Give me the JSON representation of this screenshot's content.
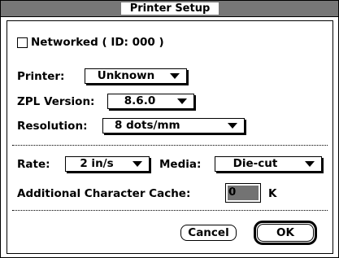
{
  "window": {
    "title": "Printer Setup"
  },
  "networked": {
    "label": "Networked ( ID:  000 )",
    "checked": false
  },
  "printer": {
    "label": "Printer:",
    "value": "Unknown"
  },
  "zpl_version": {
    "label": "ZPL Version:",
    "value": "8.6.0"
  },
  "resolution": {
    "label": "Resolution:",
    "value": "8 dots/mm"
  },
  "rate": {
    "label": "Rate:",
    "value": "2 in/s"
  },
  "media": {
    "label": "Media:",
    "value": "Die-cut"
  },
  "cache": {
    "label": "Additional Character Cache:",
    "value": "0",
    "unit": "K"
  },
  "buttons": {
    "cancel": "Cancel",
    "ok": "OK"
  }
}
